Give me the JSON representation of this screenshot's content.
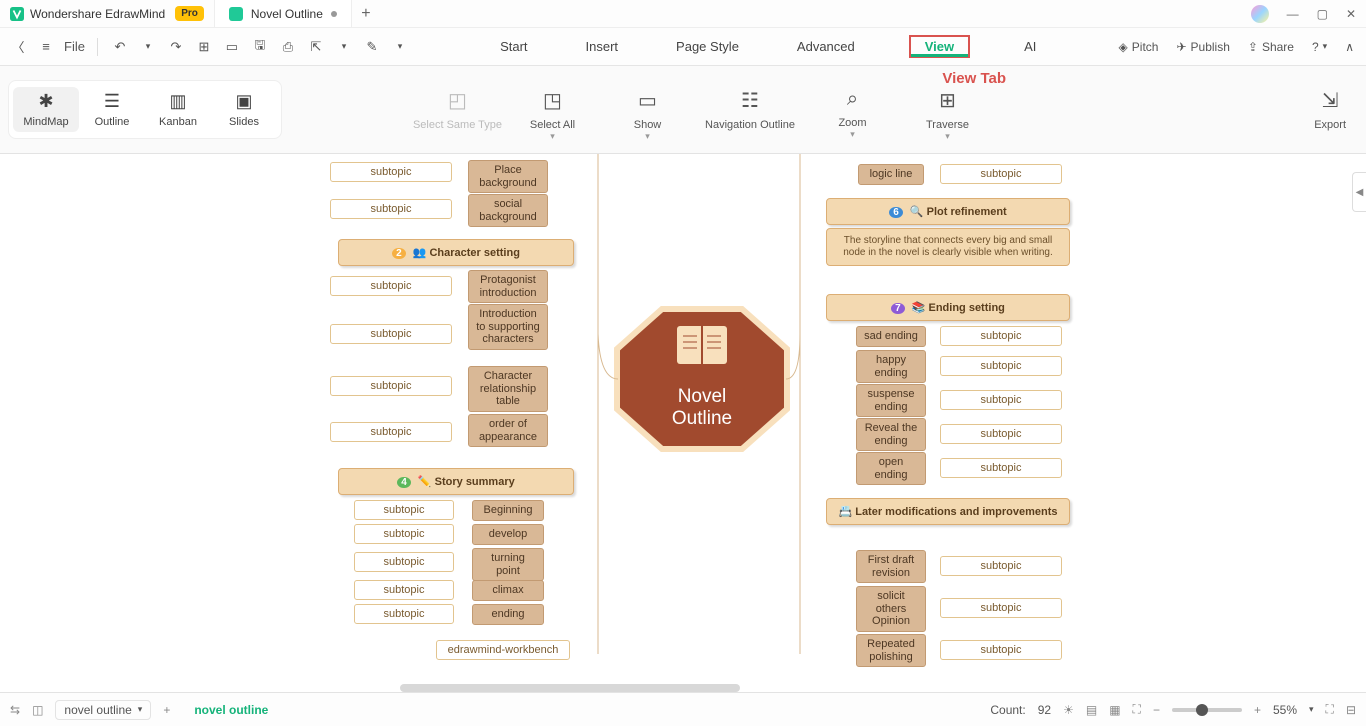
{
  "titlebar": {
    "app_name": "Wondershare EdrawMind",
    "pro_badge": "Pro",
    "doc_title": "Novel Outline"
  },
  "menubar": {
    "file": "File",
    "items": [
      "Start",
      "Insert",
      "Page Style",
      "Advanced",
      "View",
      "AI"
    ],
    "active": "View",
    "right": {
      "pitch": "Pitch",
      "publish": "Publish",
      "share": "Share"
    }
  },
  "annotation": "View Tab",
  "ribbon": {
    "modes": [
      "MindMap",
      "Outline",
      "Kanban",
      "Slides"
    ],
    "tools": {
      "select_same": "Select Same Type",
      "select_all": "Select All",
      "show": "Show",
      "nav_outline": "Navigation Outline",
      "zoom": "Zoom",
      "traverse": "Traverse"
    },
    "export": "Export"
  },
  "mindmap": {
    "central": "Novel\nOutline",
    "left": {
      "background": {
        "items": [
          {
            "sub": "Place background",
            "leaf": "subtopic"
          },
          {
            "sub": "social background",
            "leaf": "subtopic"
          }
        ]
      },
      "character": {
        "title": "Character setting",
        "icon_badge": "2",
        "items": [
          {
            "sub": "Protagonist introduction",
            "leaf": "subtopic"
          },
          {
            "sub": "Introduction to supporting characters",
            "leaf": "subtopic"
          },
          {
            "sub": "Character relationship table",
            "leaf": "subtopic"
          },
          {
            "sub": "order of appearance",
            "leaf": "subtopic"
          }
        ]
      },
      "summary": {
        "title": "Story summary",
        "icon_badge": "4",
        "items": [
          {
            "sub": "Beginning",
            "leaf": "subtopic"
          },
          {
            "sub": "develop",
            "leaf": "subtopic"
          },
          {
            "sub": "turning point",
            "leaf": "subtopic"
          },
          {
            "sub": "climax",
            "leaf": "subtopic"
          },
          {
            "sub": "ending",
            "leaf": "subtopic"
          }
        ]
      },
      "workbench": "edrawmind-workbench"
    },
    "right": {
      "toprow": {
        "sub": "logic line",
        "leaf": "subtopic"
      },
      "plot": {
        "title": "Plot refinement",
        "icon_badge": "6",
        "desc": "The storyline that connects every big and small node in the novel is clearly visible when writing."
      },
      "ending": {
        "title": "Ending setting",
        "icon_badge": "7",
        "items": [
          {
            "sub": "sad ending",
            "leaf": "subtopic"
          },
          {
            "sub": "happy ending",
            "leaf": "subtopic"
          },
          {
            "sub": "suspense ending",
            "leaf": "subtopic"
          },
          {
            "sub": "Reveal the ending",
            "leaf": "subtopic"
          },
          {
            "sub": "open ending",
            "leaf": "subtopic"
          }
        ]
      },
      "later": {
        "title": "Later modifications and improvements",
        "items": [
          {
            "sub": "First draft revision",
            "leaf": "subtopic"
          },
          {
            "sub": "solicit others Opinion",
            "leaf": "subtopic"
          },
          {
            "sub": "Repeated polishing",
            "leaf": "subtopic"
          }
        ]
      }
    }
  },
  "status": {
    "doc_combo": "novel outline",
    "breadcrumb": "novel outline",
    "count_label": "Count:",
    "count_value": "92",
    "zoom": "55%"
  }
}
